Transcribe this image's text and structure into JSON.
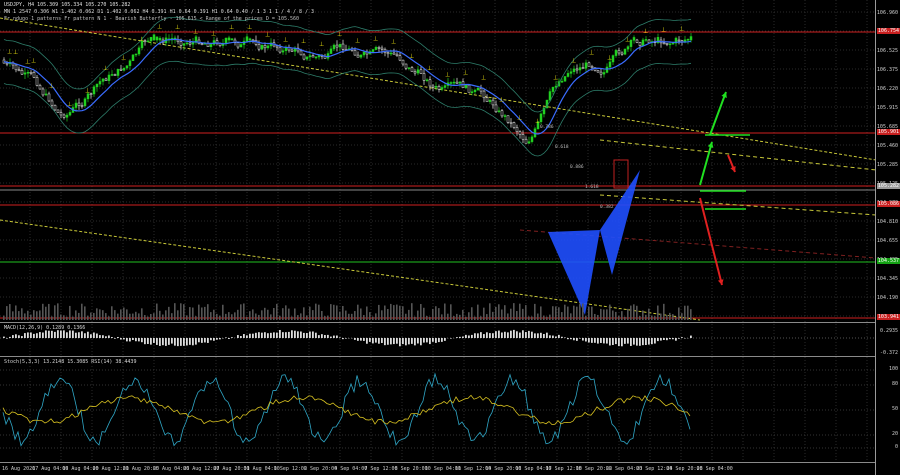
{
  "header": {
    "symbol_line": "USDJPY, H4  105.309 105.334 105.270 105.282",
    "info_line": "MN 1 2547   0.306  W1 1.402   0.062  D1 1.402   0.062  H4 0.391  H1 0.64  0.391  H1 0.64  0.40 / 1  3  1 1 / 4 / 8 / 3",
    "pattern_line": "Fr ndugo 1 patterns  Fr pattern N 1 - Bearish Butterfly - 105.615 < Range of the prices D = 105.560",
    "macd_label": "MACD(12,26,9) 0.1289 0.1366",
    "stoch_label": "Stoch(5,3,3) 13.2148 15.3085  RSI(14) 38.4439"
  },
  "price_axis": [
    "106.960",
    "106.790",
    "106.525",
    "106.375",
    "106.220",
    "105.915",
    "105.685",
    "105.460",
    "105.285",
    "105.125",
    "104.970",
    "104.810",
    "104.655",
    "104.495",
    "104.345",
    "104.190",
    "103.940"
  ],
  "price_badges": [
    {
      "text": "106.754",
      "color": "#c82020"
    },
    {
      "text": "105.901",
      "color": "#c82020"
    },
    {
      "text": "105.282",
      "color": "#9a9a9a"
    },
    {
      "text": "105.086",
      "color": "#c82020"
    },
    {
      "text": "104.537",
      "color": "#14a214"
    },
    {
      "text": "103.941",
      "color": "#c82020"
    }
  ],
  "macd_axis": [
    "0.2935",
    "-0.372"
  ],
  "stoch_axis": [
    "100",
    "80",
    "50",
    "20",
    "0"
  ],
  "time_axis": [
    "16 Aug 2020",
    "17 Aug 04:00",
    "19 Aug 04:00",
    "20 Aug 12:00",
    "21 Aug 20:00",
    "25 Aug 04:00",
    "26 Aug 12:00",
    "27 Aug 20:00",
    "31 Aug 04:00",
    "1 Sep 12:00",
    "2 Sep 20:00",
    "4 Sep 04:00",
    "7 Sep 12:00",
    "8 Sep 20:00",
    "10 Sep 04:00",
    "11 Sep 12:00",
    "14 Sep 20:00",
    "16 Sep 04:00",
    "17 Sep 12:00",
    "18 Sep 20:00",
    "22 Sep 04:00",
    "23 Sep 12:00",
    "24 Sep 20:00",
    "28 Sep 04:00"
  ],
  "pattern_labels": [
    "0.786",
    "0.618",
    "0.886",
    "1.618",
    "0.382"
  ],
  "colors": {
    "bull": "#20d020",
    "bear": "#e8e8e8",
    "grid": "#2a2a2a",
    "resistance": "#d02020",
    "support": "#20c020",
    "harmonic": "#1f4fff",
    "trend": "#c8c838"
  }
}
